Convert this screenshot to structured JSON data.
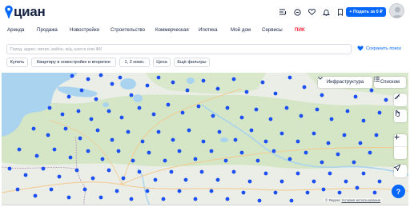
{
  "header": {
    "logo_text": "циан",
    "post_button": "+ Подать за 0 ₽",
    "icons": [
      "compare-icon",
      "chat-icon",
      "favorites-icon",
      "notifications-icon",
      "bookmark-icon"
    ]
  },
  "nav": {
    "items": [
      "Аренда",
      "Продажа",
      "Новостройки",
      "Строительство",
      "Коммерческая",
      "Ипотека",
      "Мой дом",
      "Сервисы",
      "ПИК"
    ]
  },
  "search": {
    "placeholder": "Город, адрес, метро, район, ж/д, шоссе или ЖК",
    "save_label": "Сохранить поиск"
  },
  "filters": [
    "Купить",
    "Квартиру в новостройке и вторичке",
    "1, 2 комн.",
    "Цена",
    "Ещё фильтры"
  ],
  "map": {
    "infrastructure_label": "Инфраструктура",
    "list_label": "Списком",
    "attribution": "© Яндекс",
    "attribution_link": "Условия использования",
    "help_label": "?"
  },
  "colors": {
    "brand": "#0468ff",
    "pik": "#ff1f34",
    "text": "#152242",
    "marker": "#1b57f5"
  }
}
